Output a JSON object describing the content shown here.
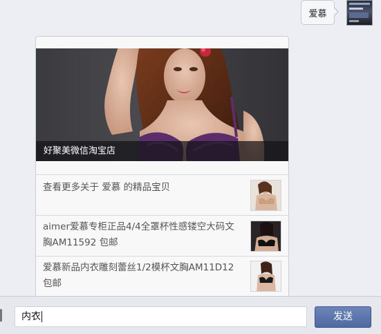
{
  "chat": {
    "outgoing_message": "爱慕",
    "card": {
      "cover_caption": "好聚美微信淘宝店",
      "items": [
        {
          "text": "查看更多关于 爱慕 的精品宝贝"
        },
        {
          "text": "aimer爱慕专柜正品4/4全罩杯性感镂空大码文胸AM11592 包邮"
        },
        {
          "text": "爱慕新品内衣雕刻蕾丝1/2模杯文胸AM11D12 包邮"
        }
      ]
    }
  },
  "input_bar": {
    "input_value": "内衣",
    "send_label": "发送"
  },
  "colors": {
    "background": "#eceef4",
    "send_button": "#5a74ab",
    "caption_overlay": "#141418"
  }
}
